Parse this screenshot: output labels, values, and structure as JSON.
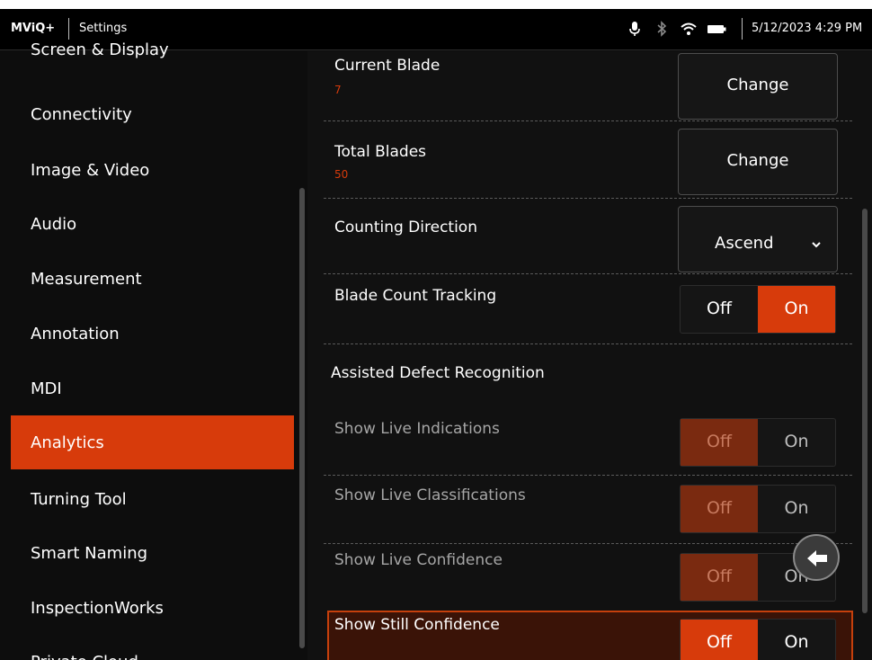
{
  "status_bar": {
    "app_name": "MViQ+",
    "page": "Settings",
    "datetime": "5/12/2023  4:29 PM",
    "icons": [
      "microphone-icon",
      "bluetooth-icon",
      "wifi-icon",
      "battery-icon"
    ]
  },
  "sidebar": {
    "items": [
      {
        "label": "Screen & Display",
        "active": false
      },
      {
        "label": "Connectivity",
        "active": false
      },
      {
        "label": "Image & Video",
        "active": false
      },
      {
        "label": "Audio",
        "active": false
      },
      {
        "label": "Measurement",
        "active": false
      },
      {
        "label": "Annotation",
        "active": false
      },
      {
        "label": "MDI",
        "active": false
      },
      {
        "label": "Analytics",
        "active": true
      },
      {
        "label": "Turning Tool",
        "active": false
      },
      {
        "label": "Smart Naming",
        "active": false
      },
      {
        "label": "InspectionWorks",
        "active": false
      },
      {
        "label": "Private Cloud",
        "active": false
      }
    ]
  },
  "main": {
    "current_blade": {
      "title": "Current Blade",
      "value": "7",
      "button": "Change"
    },
    "total_blades": {
      "title": "Total Blades",
      "value": "50",
      "button": "Change"
    },
    "counting_direction": {
      "title": "Counting Direction",
      "selected": "Ascend"
    },
    "blade_count_tracking": {
      "title": "Blade Count Tracking",
      "off": "Off",
      "on": "On",
      "state": "On"
    },
    "adr_header": "Assisted Defect Recognition",
    "show_live_indications": {
      "title": "Show Live Indications",
      "off": "Off",
      "on": "On",
      "state": "Off"
    },
    "show_live_classifications": {
      "title": "Show Live Classifications",
      "off": "Off",
      "on": "On",
      "state": "Off"
    },
    "show_live_confidence": {
      "title": "Show Live Confidence",
      "off": "Off",
      "on": "On",
      "state": "Off"
    },
    "show_still_confidence": {
      "title": "Show Still Confidence",
      "off": "Off",
      "on": "On",
      "state": "Off"
    }
  },
  "colors": {
    "accent": "#d73b0b",
    "background": "#111111",
    "value_text": "#d73b0b"
  }
}
